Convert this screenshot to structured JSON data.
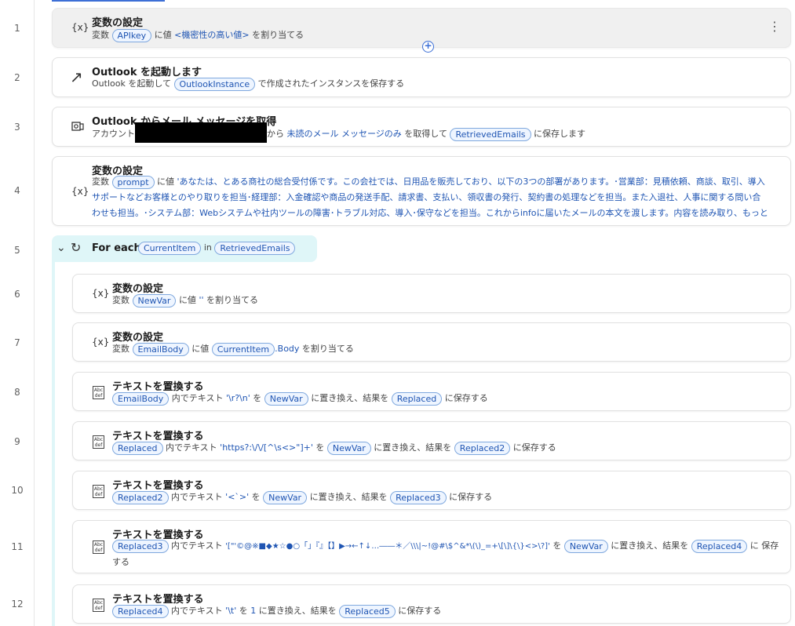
{
  "line_numbers": [
    "1",
    "2",
    "3",
    "4",
    "5",
    "6",
    "7",
    "8",
    "9",
    "10",
    "11",
    "12"
  ],
  "steps": [
    {
      "title": "変数の設定",
      "d0": "変数",
      "chip1": "APIkey",
      "d1": "に値",
      "lit": "<機密性の高い値>",
      "d2": "を割り当てる"
    },
    {
      "title": "Outlook を起動します",
      "d0": "Outlook を起動して",
      "chip1": "OutlookInstance",
      "d1": "で作成されたインスタンスを保存する"
    },
    {
      "title": "Outlook からメール メッセージを取得",
      "d0": "アカウント",
      "d1": "から",
      "lit": "未読のメール メッセージのみ",
      "d2": "を取得して",
      "chip1": "RetrievedEmails",
      "d3": "に保存します"
    },
    {
      "title": "変数の設定",
      "d0": "変数",
      "chip1": "prompt",
      "d1": "に値",
      "lit": "'あなたは、とある商社の総合受付係です。この会社では、日用品を販売しており、以下の3つの部署があります。･営業部：見積依頼、商談、取引、導入サポートなどお客様とのやり取りを担当･経理部：入金確認や商品の発送手配、請求書、支払い、領収書の発行、契約書の処理などを担当。また入退社、人事に関する問い合わせも担当。･システム部：Webシステムや社内ツールの障害･トラブル対応、導入･保守などを担当。これからinfoに届いたメールの本文を渡します。内容を読み取り、もっとも対応が適切だと思..."
    },
    {
      "title": "For each",
      "chip1": "CurrentItem",
      "d1": "in",
      "chip2": "RetrievedEmails"
    },
    {
      "title": "変数の設定",
      "d0": "変数",
      "chip1": "NewVar",
      "d1": "に値",
      "lit": "''",
      "d2": "を割り当てる"
    },
    {
      "title": "変数の設定",
      "d0": "変数",
      "chip1": "EmailBody",
      "d1": "に値",
      "chip2": "CurrentItem",
      "lit": ".Body",
      "d2": "を割り当てる"
    },
    {
      "title": "テキストを置換する",
      "chip1": "EmailBody",
      "d1": "内でテキスト",
      "lit": "'\\r?\\n'",
      "d2": "を",
      "chip2": "NewVar",
      "d3": "に置き換え、結果を",
      "chip3": "Replaced",
      "d4": "に保存する"
    },
    {
      "title": "テキストを置換する",
      "chip1": "Replaced",
      "d1": "内でテキスト",
      "lit": "'https?:\\/\\/[^\\s<>\"]+'",
      "d2": "を",
      "chip2": "NewVar",
      "d3": "に置き換え、結果を",
      "chip3": "Replaced2",
      "d4": "に保存する"
    },
    {
      "title": "テキストを置換する",
      "chip1": "Replaced2",
      "d1": "内でテキスト",
      "lit": "'<`>'",
      "d2": "を",
      "chip2": "NewVar",
      "d3": "に置き換え、結果を",
      "chip3": "Replaced3",
      "d4": "に保存する"
    },
    {
      "title": "テキストを置換する",
      "chip1": "Replaced3",
      "d1": "内でテキスト",
      "lit": "'[\"'©@※■◆★☆●○「」『』【】▶→←↑↓…――＊／\\\\\\|~!@#\\$^&*\\(\\)_=+\\[\\]\\{\\}<>\\?]'",
      "d2": "を",
      "chip2": "NewVar",
      "d3": "に置き換え、結果を",
      "chip3": "Replaced4",
      "d4": "に",
      "d5": "保存する"
    },
    {
      "title": "テキストを置換する",
      "chip1": "Replaced4",
      "d1": "内でテキスト",
      "lit": "'\\t'",
      "d2": "を",
      "lit2": "1",
      "d3": "に置き換え、結果を",
      "chip3": "Replaced5",
      "d4": "に保存する"
    }
  ],
  "icons": {
    "variable": "{x}",
    "launch": "↗",
    "outlook": "outlook-icon",
    "loop": "↻",
    "replace_line1": "Abc",
    "replace_line2": "def",
    "kebab": "⋮",
    "add": "+",
    "collapse": "⌄"
  }
}
